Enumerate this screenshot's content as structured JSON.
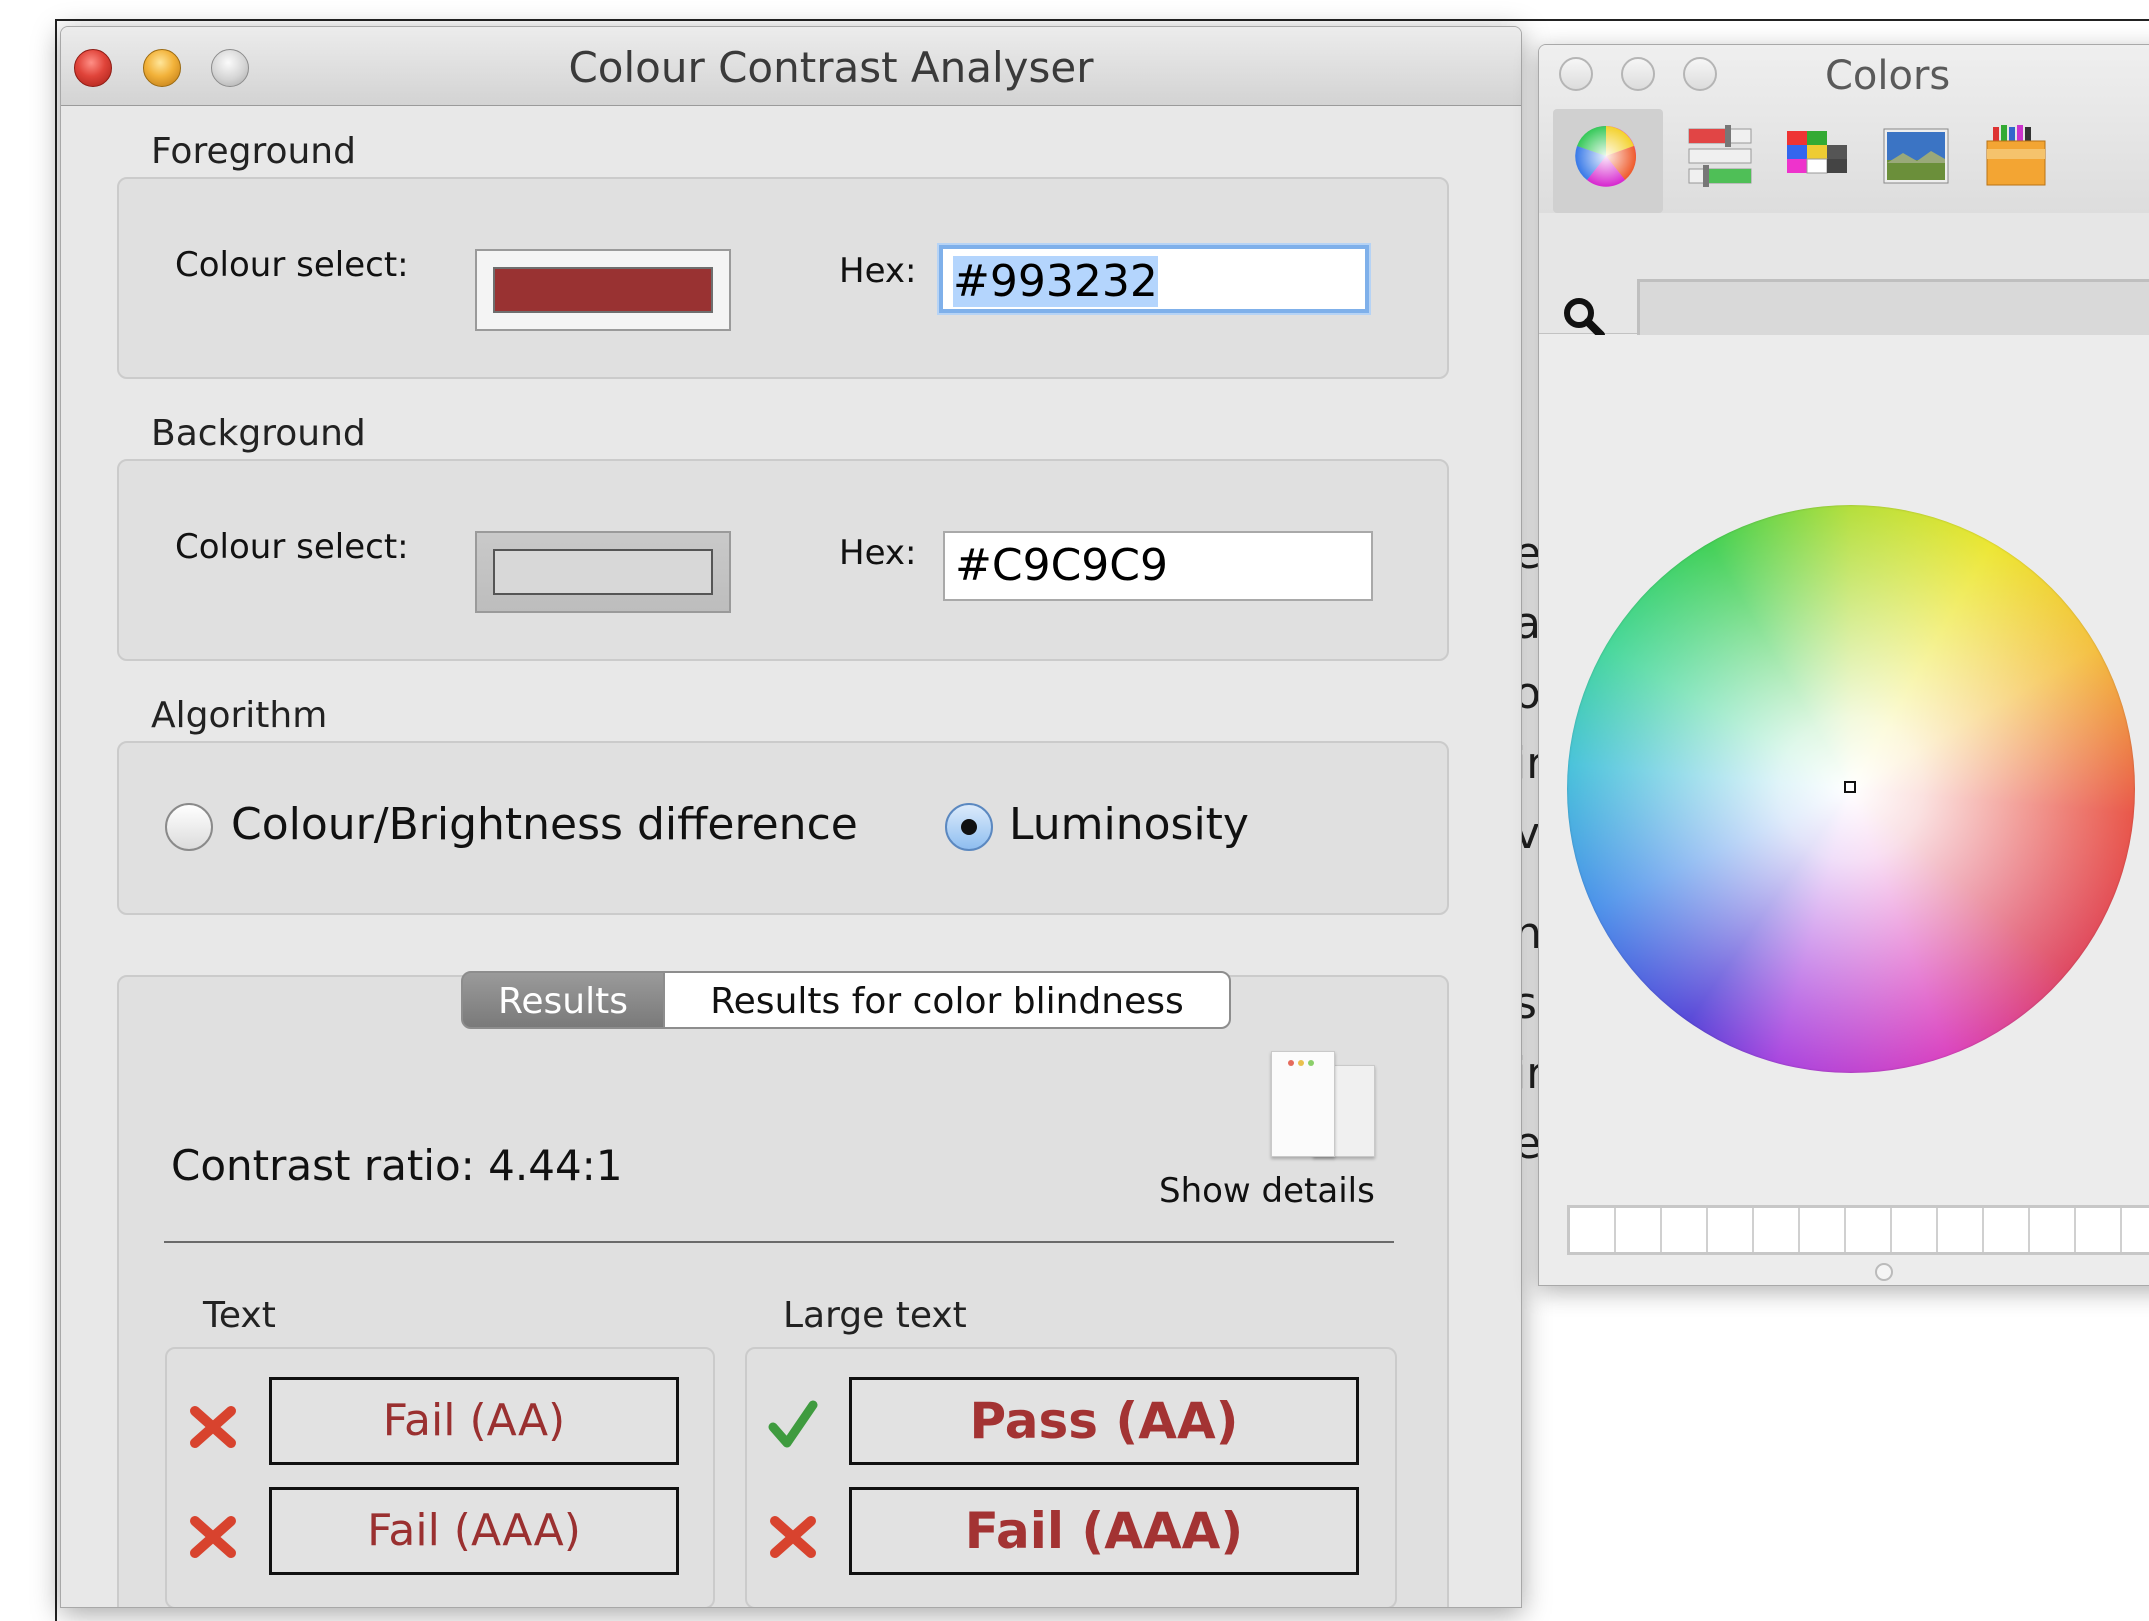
{
  "window": {
    "title": "Colour Contrast Analyser"
  },
  "foreground": {
    "label": "Foreground",
    "colour_select_label": "Colour select:",
    "hex_label": "Hex:",
    "hex_value": "#993232",
    "swatch_color": "#993232"
  },
  "background": {
    "label": "Background",
    "colour_select_label": "Colour select:",
    "hex_label": "Hex:",
    "hex_value": "#C9C9C9",
    "swatch_color": "#C9C9C9"
  },
  "algorithm": {
    "label": "Algorithm",
    "options": [
      {
        "label": "Colour/Brightness difference",
        "selected": false
      },
      {
        "label": "Luminosity",
        "selected": true
      }
    ]
  },
  "tabs": [
    {
      "label": "Results",
      "selected": true
    },
    {
      "label": "Results for color blindness",
      "selected": false
    }
  ],
  "results": {
    "contrast_ratio": "Contrast ratio: 4.44:1",
    "show_details": "Show details",
    "text": {
      "label": "Text",
      "rows": [
        {
          "status": "Fail (AA)",
          "icon": "cross-icon"
        },
        {
          "status": "Fail (AAA)",
          "icon": "cross-icon"
        }
      ]
    },
    "large_text": {
      "label": "Large text",
      "rows": [
        {
          "status": "Pass (AA)",
          "icon": "check-icon"
        },
        {
          "status": "Fail (AAA)",
          "icon": "cross-icon"
        }
      ]
    }
  },
  "colors_panel": {
    "title": "Colors",
    "toolbar": [
      "color-wheel-icon",
      "color-sliders-icon",
      "color-palettes-icon",
      "image-palettes-icon",
      "crayons-icon"
    ],
    "search_placeholder": ""
  },
  "behind_window_letters": [
    "e",
    "a",
    "o",
    "ir",
    "v",
    "n",
    "s",
    "ir",
    "e"
  ],
  "colors": {
    "fail_text": "#9a3030",
    "pass_check": "#3f9b3f",
    "fail_cross": "#d8432e",
    "focus_ring": "#7fb0ea"
  }
}
